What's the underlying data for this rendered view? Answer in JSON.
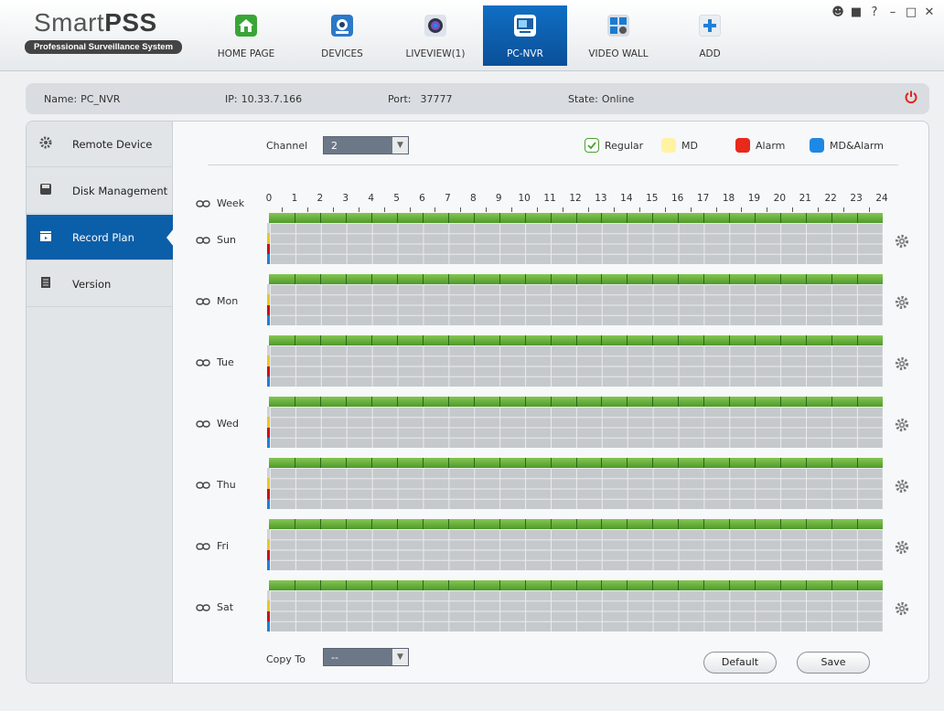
{
  "app": {
    "title_light": "Smart",
    "title_bold": "PSS",
    "subtitle": "Professional Surveillance System"
  },
  "nav": [
    {
      "label": "HOME PAGE",
      "icon": "home-icon",
      "active": false
    },
    {
      "label": "DEVICES",
      "icon": "devices-icon",
      "active": false
    },
    {
      "label": "LIVEVIEW(1)",
      "icon": "liveview-icon",
      "active": false
    },
    {
      "label": "PC-NVR",
      "icon": "pc-nvr-icon",
      "active": true
    },
    {
      "label": "VIDEO WALL",
      "icon": "video-wall-icon",
      "active": false
    },
    {
      "label": "ADD",
      "icon": "add-icon",
      "active": false
    }
  ],
  "window_controls": [
    "user-icon",
    "lock-icon",
    "help-icon",
    "minimize-icon",
    "maximize-icon",
    "close-icon"
  ],
  "device_info": {
    "name_label": "Name:",
    "name": "PC_NVR",
    "ip_label": "IP:",
    "ip": "10.33.7.166",
    "port_label": "Port:",
    "port": "37777",
    "state_label": "State:",
    "state": "Online"
  },
  "sidebar": [
    {
      "label": "Remote Device",
      "icon": "gear-icon",
      "active": false
    },
    {
      "label": "Disk Management",
      "icon": "disk-icon",
      "active": false
    },
    {
      "label": "Record Plan",
      "icon": "clapperboard-icon",
      "active": true
    },
    {
      "label": "Version",
      "icon": "document-icon",
      "active": false
    }
  ],
  "channel": {
    "label": "Channel",
    "value": "2"
  },
  "legend": [
    {
      "label": "Regular",
      "color": "#ffffff",
      "checked": true
    },
    {
      "label": "MD",
      "color": "#fff3a3",
      "checked": false
    },
    {
      "label": "Alarm",
      "color": "#e8291c",
      "checked": false
    },
    {
      "label": "MD&Alarm",
      "color": "#1e88e5",
      "checked": false
    }
  ],
  "schedule": {
    "header_label": "Week",
    "hours": [
      "0",
      "1",
      "2",
      "3",
      "4",
      "5",
      "6",
      "7",
      "8",
      "9",
      "10",
      "11",
      "12",
      "13",
      "14",
      "15",
      "16",
      "17",
      "18",
      "19",
      "20",
      "21",
      "22",
      "23",
      "24"
    ],
    "days": [
      "Sun",
      "Mon",
      "Tue",
      "Wed",
      "Thu",
      "Fri",
      "Sat"
    ],
    "regular_color": "#4f9a2a",
    "strip_colors": [
      "#e8c62a",
      "#c8101a",
      "#1e7fd8"
    ]
  },
  "copy_to": {
    "label": "Copy To",
    "value": "--"
  },
  "buttons": {
    "default": "Default",
    "save": "Save"
  }
}
